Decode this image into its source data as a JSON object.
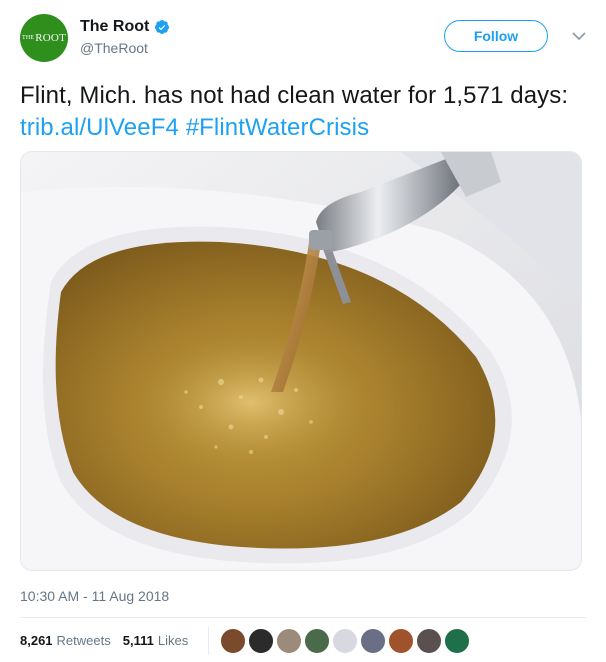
{
  "author": {
    "avatar_text_small": "THE",
    "avatar_text_main": "ROOT",
    "display_name": "The Root",
    "handle": "@TheRoot",
    "verified": true
  },
  "follow_label": "Follow",
  "tweet": {
    "text_plain": "Flint, Mich. has not had clean water for 1,571 days: ",
    "link": "trib.al/UlVeeF4",
    "hashtag": "#FlintWaterCrisis"
  },
  "photo": {
    "description_icon": "brown-water-sink-photo"
  },
  "timestamp": "10:30 AM - 11 Aug 2018",
  "stats": {
    "retweets_count": "8,261",
    "retweets_label": "Retweets",
    "likes_count": "5,111",
    "likes_label": "Likes"
  },
  "likers": [
    {
      "color": "#7a4a2c"
    },
    {
      "color": "#2b2b2b"
    },
    {
      "color": "#9c8b7a"
    },
    {
      "color": "#4a6b4a"
    },
    {
      "color": "#d8d8e0"
    },
    {
      "color": "#6a6f85"
    },
    {
      "color": "#a0522d"
    },
    {
      "color": "#5a5050"
    },
    {
      "color": "#1f6f4a"
    }
  ],
  "colors": {
    "brand_green": "#2f8f1d",
    "link_blue": "#1da1f2",
    "muted": "#657786"
  }
}
